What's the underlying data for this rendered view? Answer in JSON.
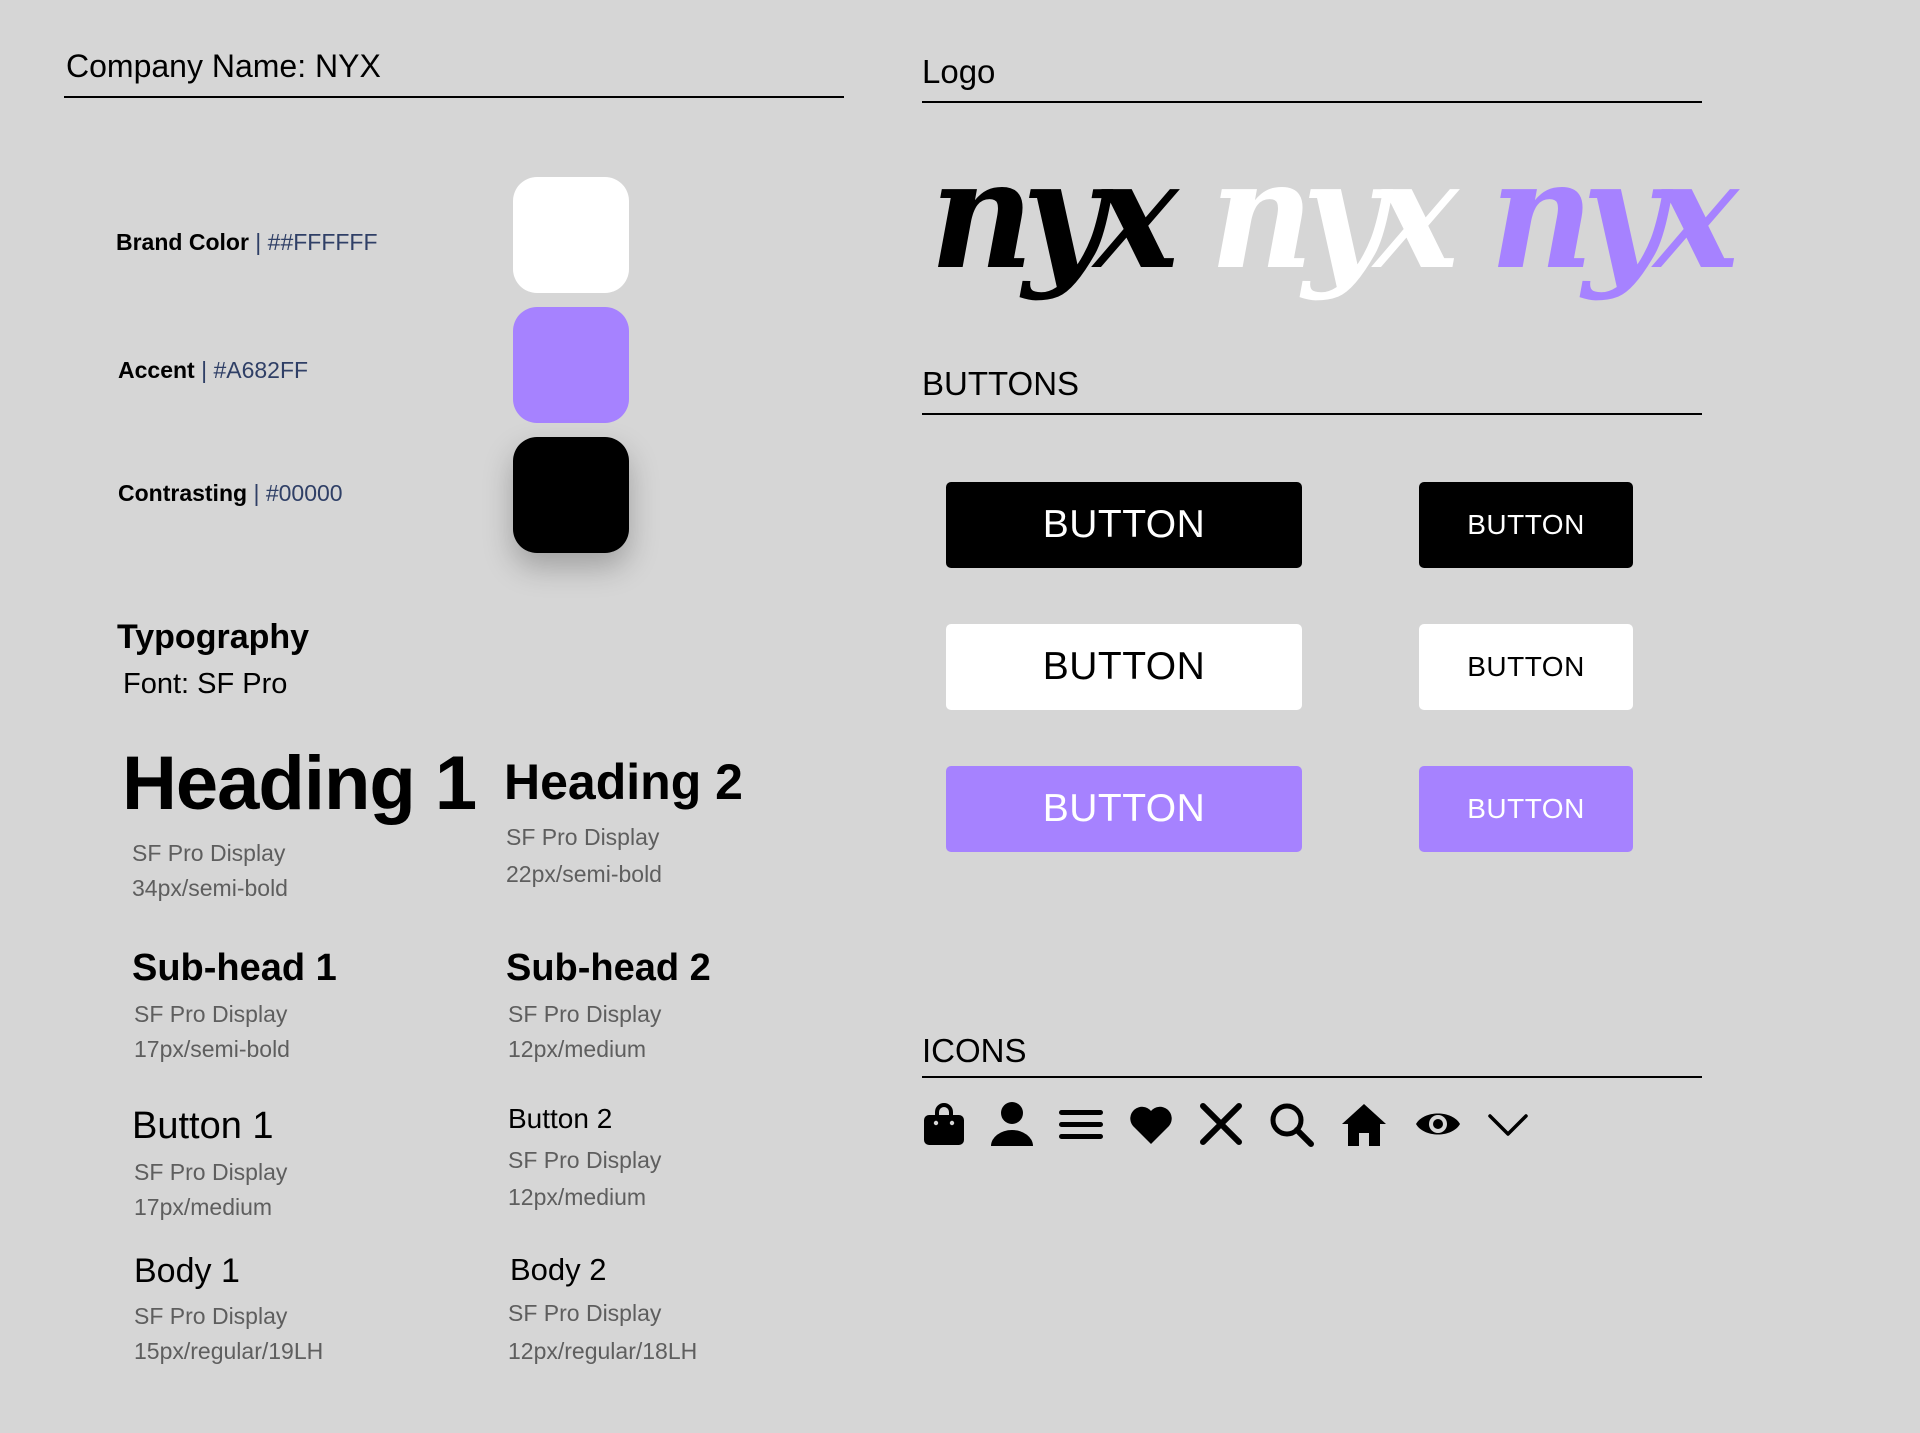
{
  "company": {
    "title": "Company Name: NYX"
  },
  "colors": {
    "items": [
      {
        "name": "Brand Color",
        "sep": " | ",
        "hex": "##FFFFFF",
        "swatch": "#ffffff"
      },
      {
        "name": "Accent",
        "sep": " | ",
        "hex": "#A682FF",
        "swatch": "#a682ff"
      },
      {
        "name": "Contrasting",
        "sep": " | ",
        "hex": "#00000",
        "swatch": "#000000"
      }
    ]
  },
  "typography": {
    "title": "Typography",
    "font": "Font: SF Pro",
    "styles": {
      "h1": {
        "name": "Heading 1",
        "family": "SF Pro Display",
        "spec": "34px/semi-bold"
      },
      "h2": {
        "name": "Heading 2",
        "family": "SF Pro Display",
        "spec": "22px/semi-bold"
      },
      "sub1": {
        "name": "Sub-head 1",
        "family": "SF Pro Display",
        "spec": "17px/semi-bold"
      },
      "sub2": {
        "name": "Sub-head 2",
        "family": "SF Pro Display",
        "spec": "12px/medium"
      },
      "btn1": {
        "name": "Button 1",
        "family": "SF Pro Display",
        "spec": "17px/medium"
      },
      "btn2": {
        "name": "Button 2",
        "family": "SF Pro Display",
        "spec": "12px/medium"
      },
      "body1": {
        "name": "Body 1",
        "family": "SF Pro Display",
        "spec": "15px/regular/19LH"
      },
      "body2": {
        "name": "Body 2",
        "family": "SF Pro Display",
        "spec": "12px/regular/18LH"
      }
    }
  },
  "logo": {
    "title": "Logo",
    "wordmark": "nyx",
    "variants": [
      {
        "color": "#000000"
      },
      {
        "color": "#ffffff"
      },
      {
        "color": "#a682ff"
      }
    ]
  },
  "buttons": {
    "title": "BUTTONS",
    "label": "BUTTON"
  },
  "icons": {
    "title": "ICONS",
    "items": [
      "shopping-bag-icon",
      "user-icon",
      "menu-icon",
      "heart-icon",
      "close-icon",
      "search-icon",
      "home-icon",
      "eye-icon",
      "chevron-down-icon"
    ]
  }
}
